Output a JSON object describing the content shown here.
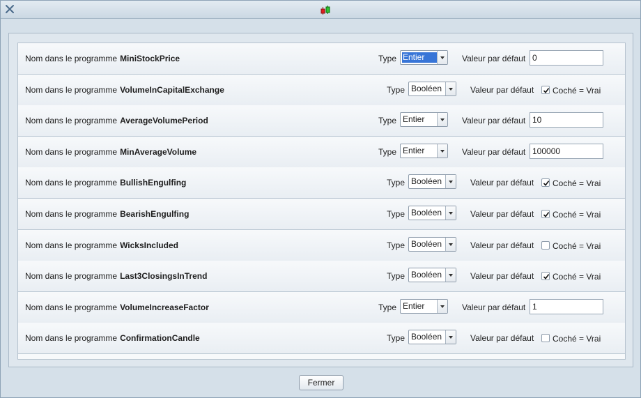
{
  "window": {
    "close_icon": "close-icon",
    "app_icon": "candlestick-chart-icon"
  },
  "labels": {
    "name_prefix": "Nom dans le programme",
    "type": "Type",
    "default_value": "Valeur par défaut",
    "checked_true": "Coché = Vrai"
  },
  "params": [
    {
      "name": "MiniStockPrice",
      "type": "Entier",
      "type_selected": true,
      "value": "0"
    },
    {
      "name": "VolumeInCapitalExchange",
      "type": "Booléen",
      "checked": true
    },
    {
      "name": "AverageVolumePeriod",
      "type": "Entier",
      "value": "10"
    },
    {
      "name": "MinAverageVolume",
      "type": "Entier",
      "value": "100000"
    },
    {
      "name": "BullishEngulfing",
      "type": "Booléen",
      "checked": true
    },
    {
      "name": "BearishEngulfing",
      "type": "Booléen",
      "checked": true
    },
    {
      "name": "WicksIncluded",
      "type": "Booléen",
      "checked": false
    },
    {
      "name": "Last3ClosingsInTrend",
      "type": "Booléen",
      "checked": true
    },
    {
      "name": "VolumeIncreaseFactor",
      "type": "Entier",
      "value": "1"
    },
    {
      "name": "ConfirmationCandle",
      "type": "Booléen",
      "checked": false
    }
  ],
  "footer": {
    "close_label": "Fermer"
  },
  "colors": {
    "selection": "#3875d7",
    "window_bg": "#d5e0e9"
  }
}
